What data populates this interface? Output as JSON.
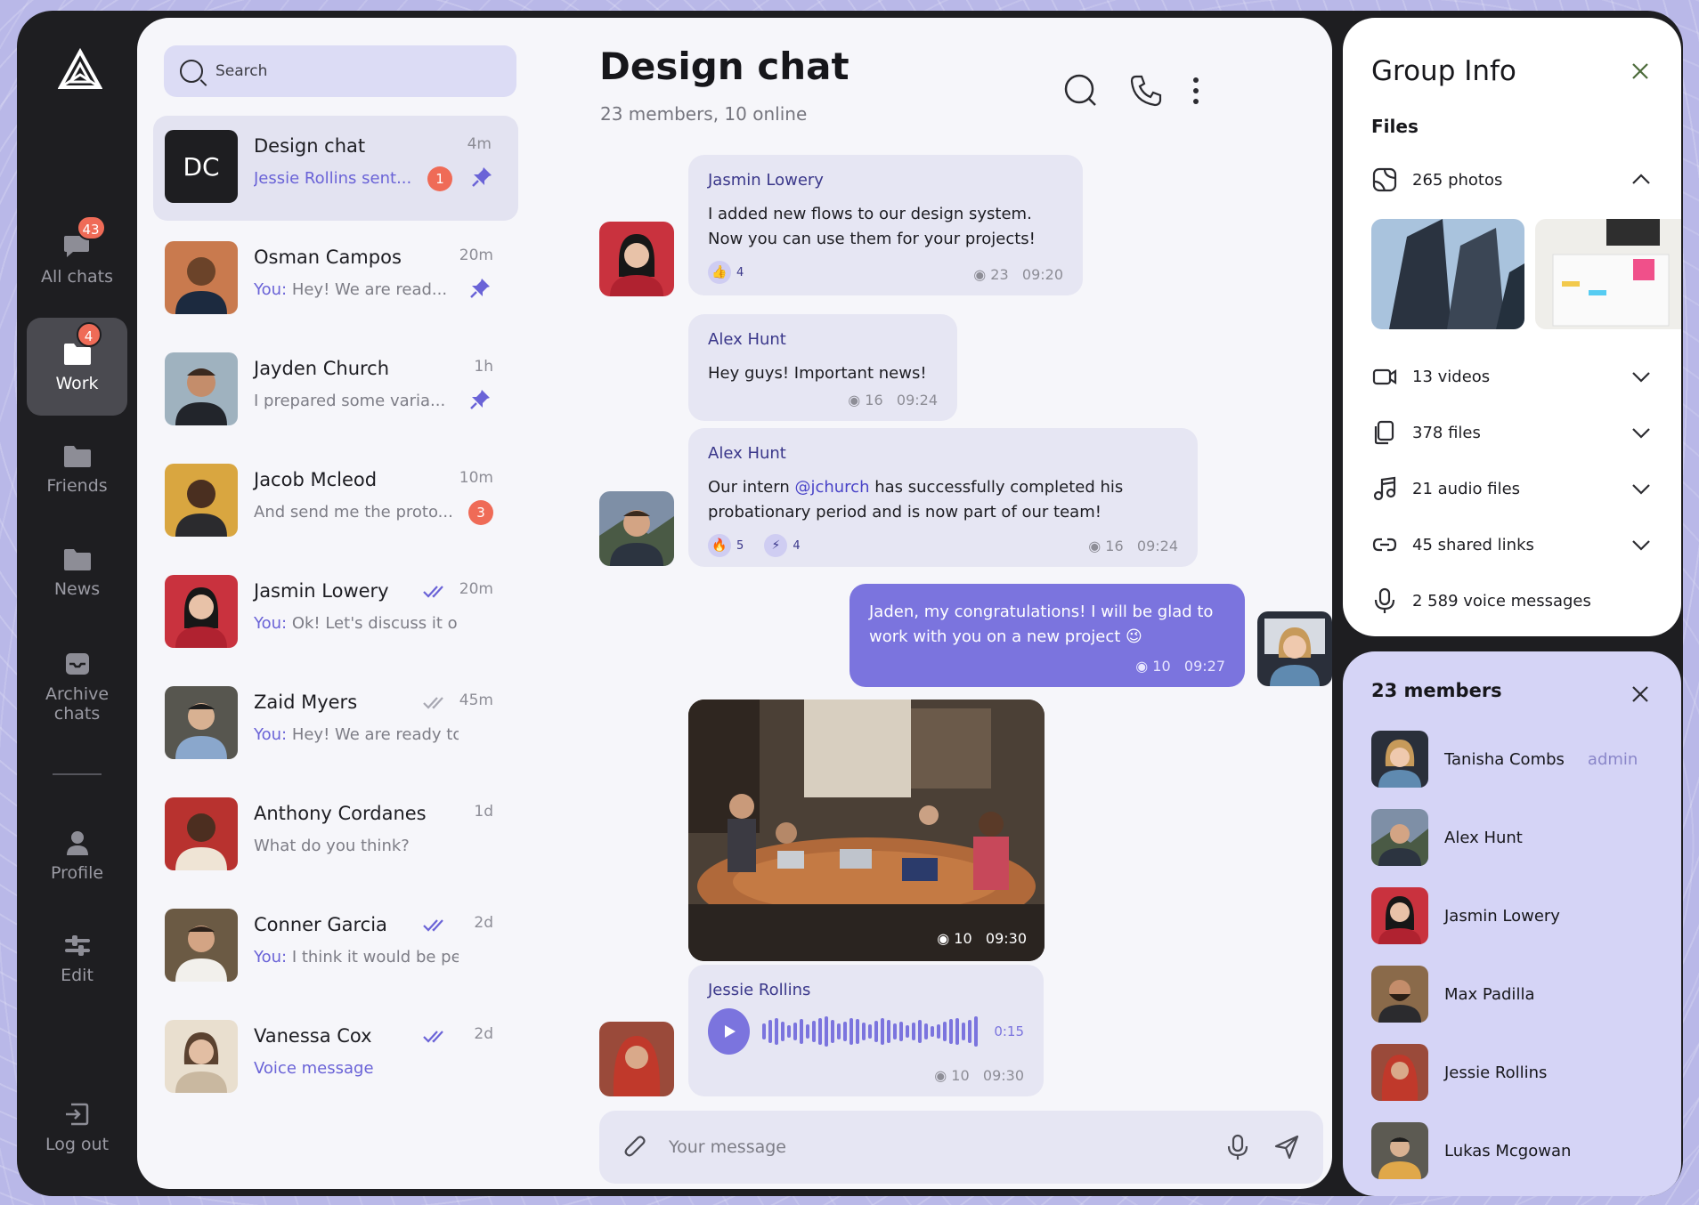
{
  "sidebar": {
    "items": [
      {
        "label": "All chats",
        "badge": "43"
      },
      {
        "label": "Work",
        "badge": "4"
      },
      {
        "label": "Friends"
      },
      {
        "label": "News"
      },
      {
        "label": "Archive chats"
      },
      {
        "label": "Profile"
      },
      {
        "label": "Edit"
      },
      {
        "label": "Log out"
      }
    ]
  },
  "search": {
    "placeholder": "Search"
  },
  "chats": [
    {
      "initials": "DC",
      "name": "Design chat",
      "time": "4m",
      "preview": "Jessie Rollins sent...",
      "unread": "1",
      "pinned": true
    },
    {
      "name": "Osman Campos",
      "time": "20m",
      "you": "You:",
      "preview": " Hey! We are read...",
      "pinned": true
    },
    {
      "name": "Jayden Church",
      "time": "1h",
      "preview": "I prepared some varia...",
      "pinned": true
    },
    {
      "name": "Jacob Mcleod",
      "time": "10m",
      "preview": "And send me the proto...",
      "unread": "3"
    },
    {
      "name": "Jasmin Lowery",
      "time": "20m",
      "you": "You:",
      "preview": " Ok! Let's discuss it on th..."
    },
    {
      "name": "Zaid Myers",
      "time": "45m",
      "you": "You:",
      "preview": " Hey! We are ready to in..."
    },
    {
      "name": "Anthony Cordanes",
      "time": "1d",
      "preview": "What do you think?"
    },
    {
      "name": "Conner Garcia",
      "time": "2d",
      "you": "You:",
      "preview": " I think it would be perfe..."
    },
    {
      "name": "Vanessa Cox",
      "time": "2d",
      "preview": "Voice message"
    }
  ],
  "conversation": {
    "title": "Design chat",
    "subtitle": "23 members, 10 online",
    "messages": [
      {
        "author": "Jasmin Lowery",
        "line1": "I added new flows to our design system.",
        "line2": "Now you can use them for your projects!",
        "reaction1": "4",
        "views": "23",
        "time": "09:20"
      },
      {
        "author": "Alex Hunt",
        "text": "Hey guys! Important news!",
        "views": "16",
        "time": "09:24"
      },
      {
        "author": "Alex Hunt",
        "pre": "Our intern ",
        "mention": "@jchurch",
        "post": " has successfully completed his",
        "line2": "probationary period and is now part of our team!",
        "reaction1": "5",
        "reaction2": "4",
        "views": "16",
        "time": "09:24"
      },
      {
        "line1": "Jaden, my congratulations! I will be glad to",
        "line2": "work with you on a new project 😉",
        "views": "10",
        "time": "09:27"
      },
      {
        "views": "10",
        "time": "09:30"
      },
      {
        "author": "Jessie Rollins",
        "duration": "0:15",
        "views": "10",
        "time": "09:30"
      }
    ]
  },
  "composer": {
    "placeholder": "Your message"
  },
  "group_info": {
    "title": "Group Info",
    "files_heading": "Files",
    "rows": [
      {
        "label": "265 photos"
      },
      {
        "label": "13 videos"
      },
      {
        "label": "378 files"
      },
      {
        "label": "21 audio files"
      },
      {
        "label": "45 shared links"
      },
      {
        "label": "2 589 voice messages"
      }
    ]
  },
  "members": {
    "title": "23 members",
    "list": [
      {
        "name": "Tanisha Combs",
        "role": "admin"
      },
      {
        "name": "Alex Hunt"
      },
      {
        "name": "Jasmin Lowery"
      },
      {
        "name": "Max Padilla"
      },
      {
        "name": "Jessie Rollins"
      },
      {
        "name": "Lukas Mcgowan"
      }
    ]
  },
  "colors": {
    "accent": "#7b74de",
    "badge": "#ef6b57",
    "dark": "#1e1e21",
    "members_bg": "#d5d4f6"
  }
}
